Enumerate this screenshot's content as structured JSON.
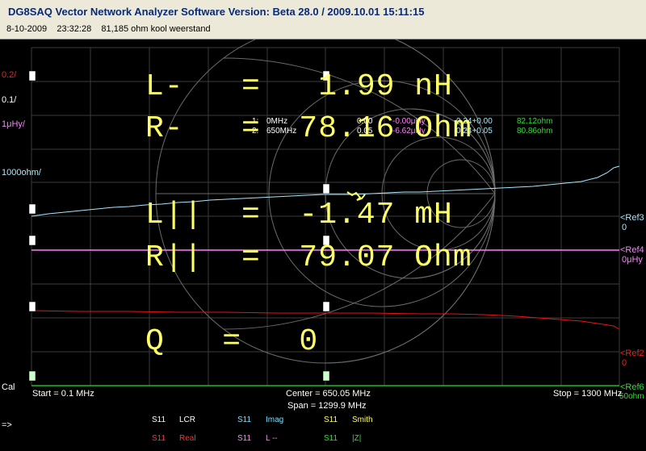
{
  "header": {
    "title": "DG8SAQ Vector Network Analyzer Software    Version:  Beta 28.0 / 2009.10.01 15:11:15",
    "subtitle": "8-10-2009    23:32:28    81,185 ohm kool weerstand"
  },
  "scale_labels": {
    "s1": "0.2/",
    "s2": "0.1/",
    "s3": "1μHy/",
    "s4": "1000ohm/",
    "cal": "Cal",
    "arrow": "=>"
  },
  "ref_labels": {
    "ref3": "<Ref3",
    "ref3_val": "0",
    "ref4": "<Ref4",
    "ref4_val": "0μHy",
    "ref2": "<Ref2",
    "ref2_val": "0",
    "ref6": "<Ref6",
    "ref6_val": "50ohm"
  },
  "markers": {
    "m1": {
      "id": "1:",
      "freq": "0MHz",
      "v1": "0.00",
      "v2": "-0.00μHy",
      "v3": "0.24+0.00",
      "v4": "82.12ohm"
    },
    "m2": {
      "id": "2:",
      "freq": "650MHz",
      "v1": "0.05",
      "v2": "-6.62μHy",
      "v3": "0.24+0.05",
      "v4": "80.86ohm"
    }
  },
  "freq_axis": {
    "start": "Start = 0.1 MHz",
    "center": "Center = 650.05 MHz",
    "span": "Span = 1299.9 MHz",
    "stop": "Stop = 1300 MHz"
  },
  "readouts": {
    "l_minus": "L-   =   1.99 nH",
    "r_minus": "R-   =  78.16 Ohm",
    "l_par": "L||  =  -1.47 mH",
    "r_par": "R||  =  79.07 Ohm",
    "q": "Q   =   0"
  },
  "legend": [
    {
      "param": "S11",
      "name": "LCR",
      "color": "#ffffff"
    },
    {
      "param": "S11",
      "name": "Imag",
      "color": "#7fdfff"
    },
    {
      "param": "S11",
      "name": "Smith",
      "color": "#ffff66"
    },
    {
      "param": "S11",
      "name": "Real",
      "color": "#ff3030"
    },
    {
      "param": "S11",
      "name": "L --",
      "color": "#ff80ff"
    },
    {
      "param": "S11",
      "name": "|Z|",
      "color": "#33dd33"
    }
  ],
  "colors": {
    "background": "#000000",
    "grid": "#444444",
    "cyan_trace": "#a8e8ff",
    "magenta_trace": "#ff80ff",
    "red_trace": "#ee1111",
    "green_trace": "#22bb22",
    "readout": "#ffff66"
  }
}
